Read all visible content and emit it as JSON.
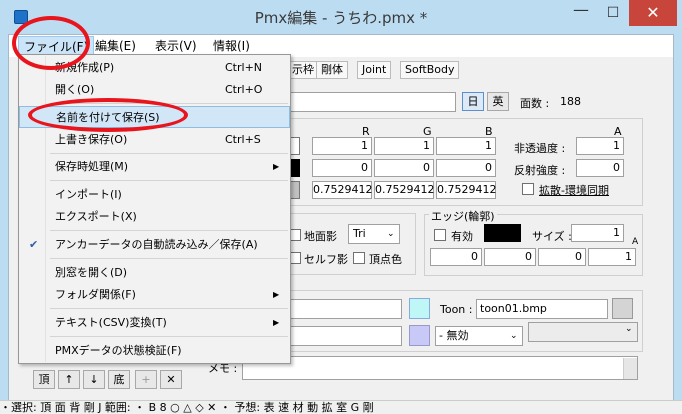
{
  "window": {
    "title": "Pmx編集 - うちわ.pmx *",
    "minimize_glyph": "—",
    "maximize_glyph": "☐",
    "close_glyph": "✕"
  },
  "menubar": {
    "file": "ファイル(F)",
    "edit": "編集(E)",
    "view": "表示(V)",
    "info": "情報(I)"
  },
  "tabs": [
    "示枠",
    "剛体",
    "Joint",
    "SoftBody"
  ],
  "header": {
    "jp_button": "日",
    "en_button": "英",
    "face_count_label": "面数 :",
    "face_count_value": "188"
  },
  "color_table": {
    "headers": [
      "R",
      "G",
      "B",
      "A"
    ],
    "rows": [
      [
        "1",
        "1",
        "1"
      ],
      [
        "0",
        "0",
        "0"
      ],
      [
        "0.7529412",
        "0.7529412",
        "0.7529412"
      ]
    ],
    "opacity_label": "非透過度 :",
    "opacity_value": "1",
    "reflect_label": "反射強度 :",
    "reflect_value": "0",
    "diffuse_sync_label": "拡散-環境同期"
  },
  "drawing": {
    "ground_shadow": "地面影",
    "self_shadow": "セルフ影",
    "vertex_color": "頂点色",
    "mode_value": "Tri"
  },
  "edge": {
    "group_label": "エッジ(輪郭)",
    "enabled_label": "有効",
    "size_label": "サイズ :",
    "size_value": "1",
    "alpha_header": "A",
    "values": [
      "0",
      "0",
      "0",
      "1"
    ]
  },
  "texture": {
    "toon_label": "Toon :",
    "toon_value": "toon01.bmp",
    "sphere_mode": "- 無効",
    "memo_label": "メモ :"
  },
  "file_menu": {
    "items": [
      {
        "label": "新規作成(P)",
        "shortcut": "Ctrl+N"
      },
      {
        "label": "開く(O)",
        "shortcut": "Ctrl+O"
      },
      {
        "label": "名前を付けて保存(S)",
        "shortcut": ""
      },
      {
        "label": "上書き保存(O)",
        "shortcut": "Ctrl+S"
      },
      {
        "label": "保存時処理(M)",
        "shortcut": ""
      },
      {
        "label": "インポート(I)",
        "shortcut": ""
      },
      {
        "label": "エクスポート(X)",
        "shortcut": ""
      },
      {
        "label": "アンカーデータの自動読み込み／保存(A)",
        "shortcut": ""
      },
      {
        "label": "別窓を開く(D)",
        "shortcut": ""
      },
      {
        "label": "フォルダ関係(F)",
        "shortcut": ""
      },
      {
        "label": "テキスト(CSV)変換(T)",
        "shortcut": ""
      },
      {
        "label": "PMXデータの状態検証(F)",
        "shortcut": ""
      }
    ],
    "submenu_arrow": "▶",
    "check_mark": "✔"
  },
  "bottom_buttons": {
    "top": "頂",
    "up": "↑",
    "down": "↓",
    "bottom": "底",
    "add": "+",
    "delete": "✕"
  },
  "statusbar": {
    "text": "・選択: 頂 面 背 剛 J   範囲:   ・ B 8 ○ △ ◇ ✕   ・ 予想: 表 速 材 動 拡 室 G 剛"
  },
  "annotations": {
    "highlight_color": "#e8151d",
    "accent_color": "#cce4f7"
  }
}
